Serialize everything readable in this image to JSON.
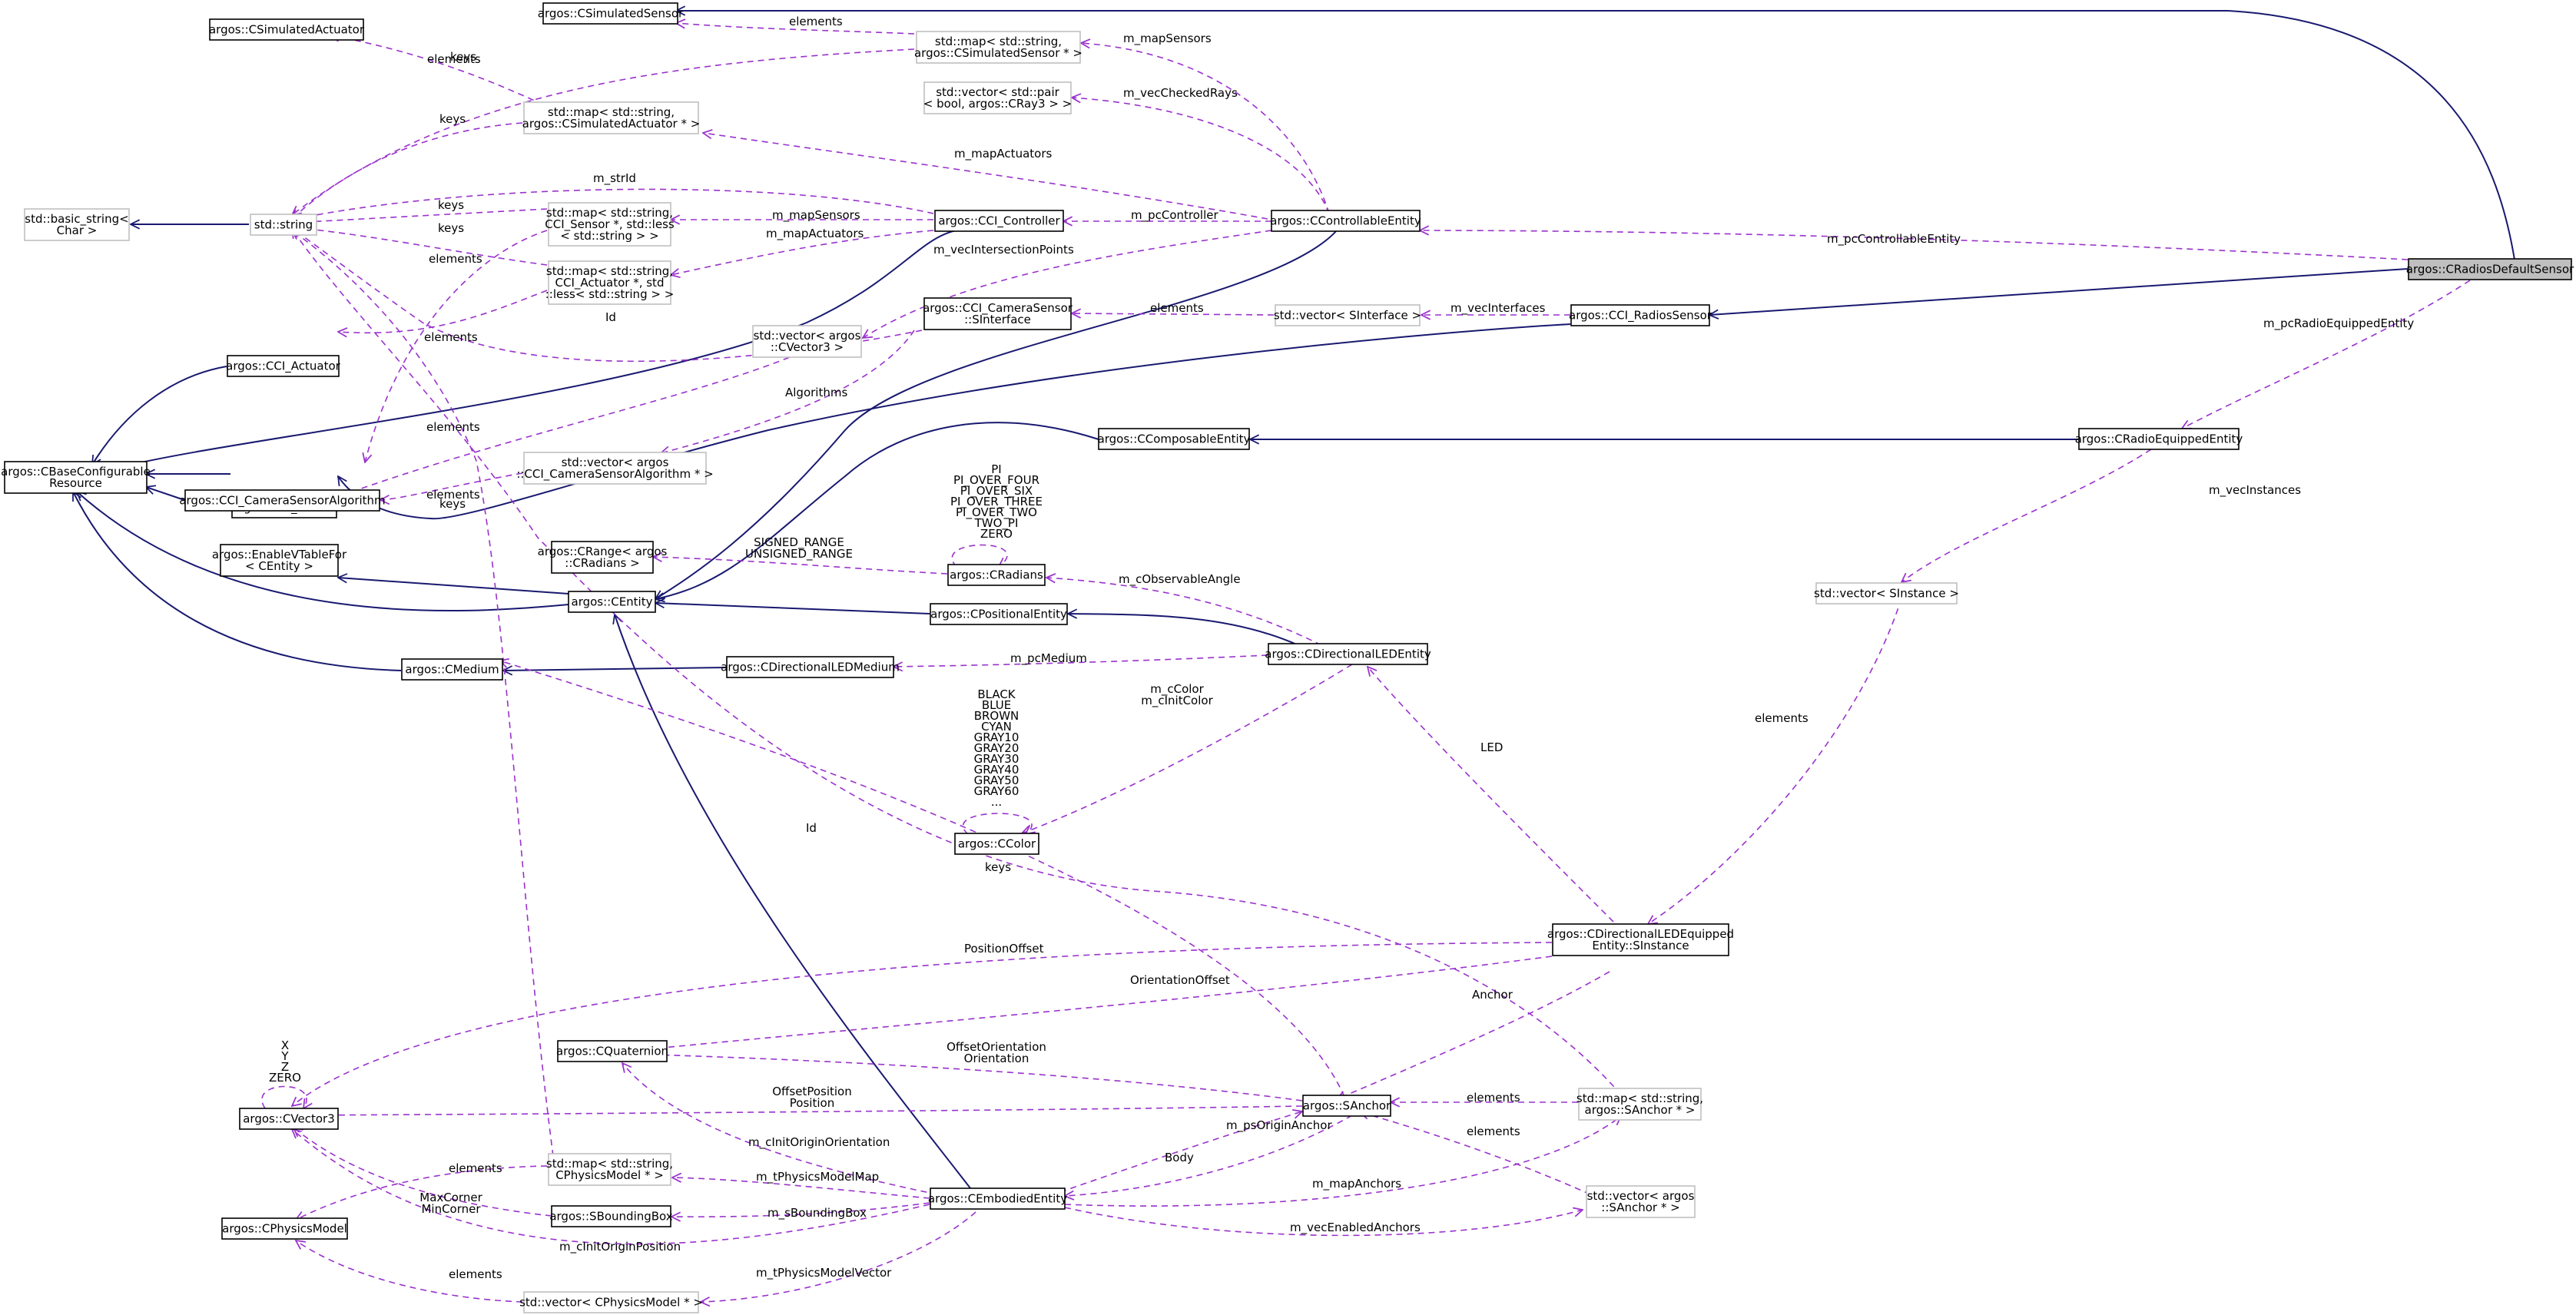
{
  "nodes": {
    "simulatedSensor": [
      "argos::CSimulatedSensor"
    ],
    "simulatedActuator": [
      "argos::CSimulatedActuator"
    ],
    "mapSimSensor": [
      "std::map< std::string,",
      "argos::CSimulatedSensor * >"
    ],
    "vectorPair": [
      "std::vector< std::pair",
      "< bool, argos::CRay3 > >"
    ],
    "mapSimActuator": [
      "std::map< std::string,",
      "argos::CSimulatedActuator * >"
    ],
    "basicString": [
      "std::basic_string<",
      "Char >"
    ],
    "stdString": [
      "std::string"
    ],
    "mapCciSensor": [
      "std::map< std::string,",
      "CCI_Sensor *, std::less",
      "< std::string > >"
    ],
    "mapCciActuator": [
      "std::map< std::string,",
      "CCI_Actuator *, std",
      "::less< std::string > >"
    ],
    "cciController": [
      "argos::CCI_Controller"
    ],
    "controllableEntity": [
      "argos::CControllableEntity"
    ],
    "radiosDefaultSensor": [
      "argos::CRadiosDefaultSensor"
    ],
    "cameraSensorInterface": [
      "argos::CCI_CameraSensor",
      "::SInterface"
    ],
    "vectorSInterface": [
      "std::vector< SInterface >"
    ],
    "cciRadiosSensor": [
      "argos::CCI_RadiosSensor"
    ],
    "vectorCVector3": [
      "std::vector< argos",
      "::CVector3 >"
    ],
    "cciActuator": [
      "argos::CCI_Actuator"
    ],
    "baseConfigurable": [
      "argos::CBaseConfigurable",
      "Resource"
    ],
    "cciSensor": [
      "argos::CCI_Sensor"
    ],
    "vectorAlgorithm": [
      "std::vector< argos",
      "::CCI_CameraSensorAlgorithm * >"
    ],
    "cameraAlgorithm": [
      "argos::CCI_CameraSensorAlgorithm"
    ],
    "composableEntity": [
      "argos::CComposableEntity"
    ],
    "radioEquippedEntity": [
      "argos::CRadioEquippedEntity"
    ],
    "enableVTable": [
      "argos::EnableVTableFor",
      "< CEntity >"
    ],
    "rangeRadians": [
      "argos::CRange< argos",
      "::CRadians >"
    ],
    "radians": [
      "argos::CRadians"
    ],
    "entity": [
      "argos::CEntity"
    ],
    "positionalEntity": [
      "argos::CPositionalEntity"
    ],
    "vectorSInstance": [
      "std::vector< SInstance >"
    ],
    "medium": [
      "argos::CMedium"
    ],
    "dirLedMedium": [
      "argos::CDirectionalLEDMedium"
    ],
    "dirLedEntity": [
      "argos::CDirectionalLEDEntity"
    ],
    "color": [
      "argos::CColor"
    ],
    "dirLedEquippedInstance": [
      "argos::CDirectionalLEDEquipped",
      "Entity::SInstance"
    ],
    "quaternion": [
      "argos::CQuaternion"
    ],
    "cvector3": [
      "argos::CVector3"
    ],
    "sAnchor": [
      "argos::SAnchor"
    ],
    "mapSAnchor": [
      "std::map< std::string,",
      "argos::SAnchor * >"
    ],
    "mapPhysicsModel": [
      "std::map< std::string,",
      "CPhysicsModel * >"
    ],
    "embodiedEntity": [
      "argos::CEmbodiedEntity"
    ],
    "vectorSAnchor": [
      "std::vector< argos",
      "::SAnchor * >"
    ],
    "physicsModel": [
      "argos::CPhysicsModel"
    ],
    "boundingBox": [
      "argos::SBoundingBox"
    ],
    "vectorPhysicsModel": [
      "std::vector< CPhysicsModel * >"
    ]
  },
  "edge_labels": {
    "elements": "elements",
    "keys": "keys",
    "m_mapSensors": "m_mapSensors",
    "m_vecCheckedRays": "m_vecCheckedRays",
    "m_mapActuators": "m_mapActuators",
    "m_strId": "m_strId",
    "m_pcController": "m_pcController",
    "m_pcControllableEntity": "m_pcControllableEntity",
    "m_vecIntersectionPoints": "m_vecIntersectionPoints",
    "m_vecInterfaces": "m_vecInterfaces",
    "m_pcRadioEquippedEntity": "m_pcRadioEquippedEntity",
    "Id": "Id",
    "Algorithms": "Algorithms",
    "m_vecInstances": "m_vecInstances",
    "radiansConsts": [
      "PI",
      "PI_OVER_FOUR",
      "PI_OVER_SIX",
      "PI_OVER_THREE",
      "PI_OVER_TWO",
      "TWO_PI",
      "ZERO"
    ],
    "rangeConsts": [
      "SIGNED_RANGE",
      "UNSIGNED_RANGE"
    ],
    "m_cObservableAngle": "m_cObservableAngle",
    "m_pcMedium": "m_pcMedium",
    "colorFields": [
      "m_cColor",
      "m_cInitColor"
    ],
    "colorConsts": [
      "BLACK",
      "BLUE",
      "BROWN",
      "CYAN",
      "GRAY10",
      "GRAY20",
      "GRAY30",
      "GRAY40",
      "GRAY50",
      "GRAY60",
      "..."
    ],
    "LED": "LED",
    "PositionOffset": "PositionOffset",
    "OrientationOffset": "OrientationOffset",
    "Anchor": "Anchor",
    "vectorConsts": [
      "X",
      "Y",
      "Z",
      "ZERO"
    ],
    "offsetOrientation": [
      "OffsetOrientation",
      "Orientation"
    ],
    "offsetPosition": [
      "OffsetPosition",
      "Position"
    ],
    "m_cInitOriginOrientation": "m_cInitOriginOrientation",
    "m_psOriginAnchor": "m_psOriginAnchor",
    "Body": "Body",
    "m_tPhysicsModelMap": "m_tPhysicsModelMap",
    "m_mapAnchors": "m_mapAnchors",
    "m_sBoundingBox": "m_sBoundingBox",
    "corners": [
      "MaxCorner",
      "MinCorner"
    ],
    "m_cInitOriginPosition": "m_cInitOriginPosition",
    "m_vecEnabledAnchors": "m_vecEnabledAnchors",
    "m_tPhysicsModelVector": "m_tPhysicsModelVector"
  }
}
